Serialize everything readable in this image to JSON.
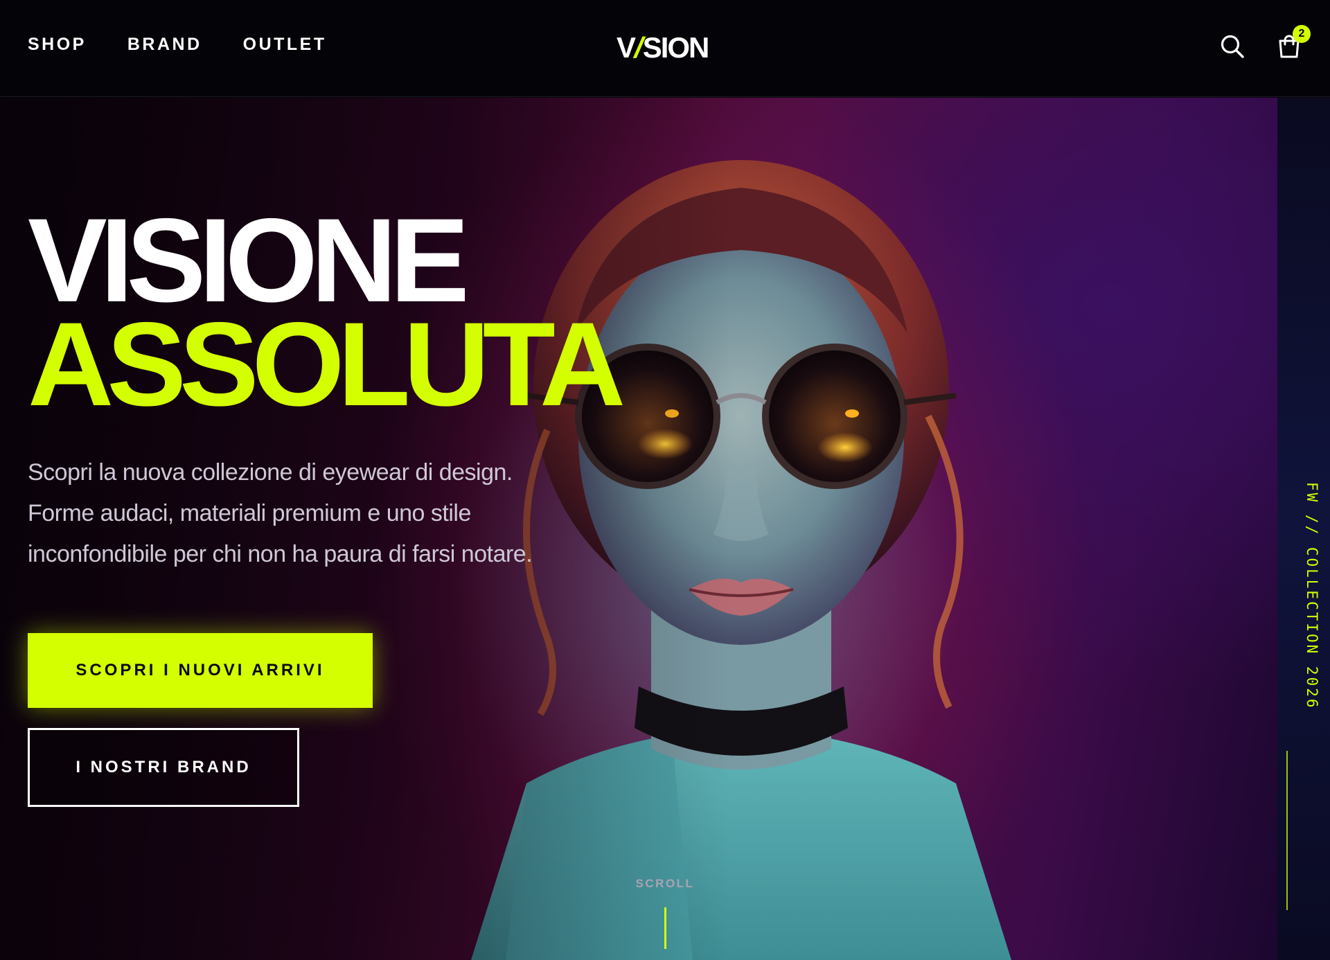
{
  "header": {
    "nav": [
      "SHOP",
      "BRAND",
      "OUTLET"
    ],
    "logo": {
      "part1": "V",
      "slash": "/",
      "part2": "SION"
    },
    "search_icon": "search-icon",
    "cart_icon": "shopping-bag-icon",
    "cart_count": "2"
  },
  "hero": {
    "title_line1": "VISIONE",
    "title_line2": "ASSOLUTA",
    "description_lines": [
      "Scopri la nuova collezione di eyewear di design.",
      "Forme audaci, materiali premium e uno stile",
      "inconfondibile per chi non ha paura di farsi notare."
    ],
    "cta_primary": "SCOPRI I NUOVI ARRIVI",
    "cta_secondary": "I NOSTRI BRAND",
    "scroll_label": "SCROLL",
    "side_label": "FW // COLLECTION 2026"
  },
  "colors": {
    "accent": "#d4ff00",
    "background": "#040307",
    "text": "#ffffff"
  }
}
